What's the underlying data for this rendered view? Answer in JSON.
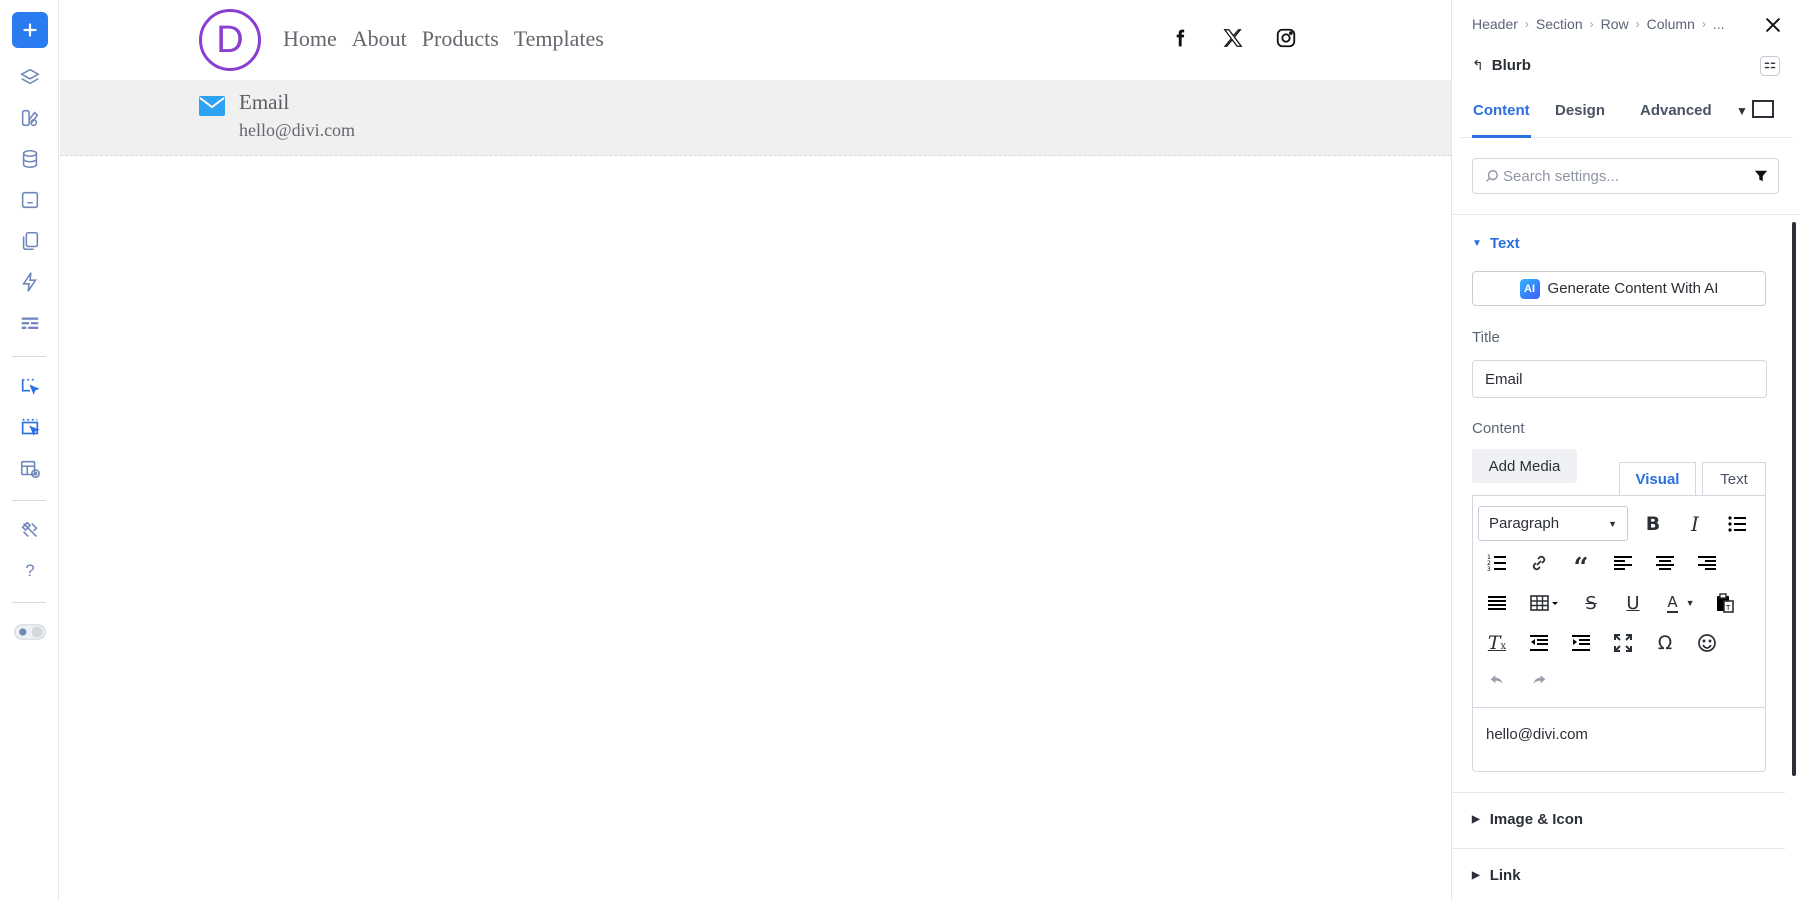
{
  "colors": {
    "accent": "#2b7bf1",
    "link_blue": "#2b6fe0",
    "logo_purple": "#8a3fd0",
    "email_icon": "#2ea3f2",
    "canvas_bar": "#f0f0f0"
  },
  "left_bar": {
    "items": [
      {
        "icon": "plus-icon"
      },
      {
        "icon": "layers-icon"
      },
      {
        "icon": "modules-icon"
      },
      {
        "icon": "database-icon"
      },
      {
        "icon": "variables-icon"
      },
      {
        "icon": "pages-icon"
      },
      {
        "icon": "lightning-icon"
      },
      {
        "icon": "layout-icon"
      },
      {
        "icon": "click-mode-icon"
      },
      {
        "icon": "hover-mode-icon"
      },
      {
        "icon": "preview-icon"
      },
      {
        "icon": "tools-icon"
      },
      {
        "icon": "help-icon"
      },
      {
        "icon": "theme-toggle-icon"
      }
    ],
    "help_label": "?"
  },
  "site": {
    "logo_letter": "D",
    "nav": [
      "Home",
      "About",
      "Products",
      "Templates"
    ],
    "social": [
      "facebook-icon",
      "x-icon",
      "instagram-icon"
    ],
    "blurb": {
      "title": "Email",
      "content": "hello@divi.com"
    }
  },
  "panel": {
    "breadcrumb": [
      "Header",
      "Section",
      "Row",
      "Column",
      "..."
    ],
    "module_name": "Blurb",
    "back_symbol": "↰",
    "tabs": [
      "Content",
      "Design",
      "Advanced"
    ],
    "active_tab": "Content",
    "search_placeholder": "Search settings...",
    "text_section": {
      "label": "Text",
      "generate_ai": "Generate Content With AI",
      "ai_badge": "AI",
      "title_label": "Title",
      "title_value": "Email",
      "content_label": "Content",
      "add_media": "Add Media",
      "editor_tabs": [
        "Visual",
        "Text"
      ],
      "paragraph_select": "Paragraph",
      "editor_content": "hello@divi.com"
    },
    "accordions": [
      "Image & Icon",
      "Link"
    ]
  }
}
